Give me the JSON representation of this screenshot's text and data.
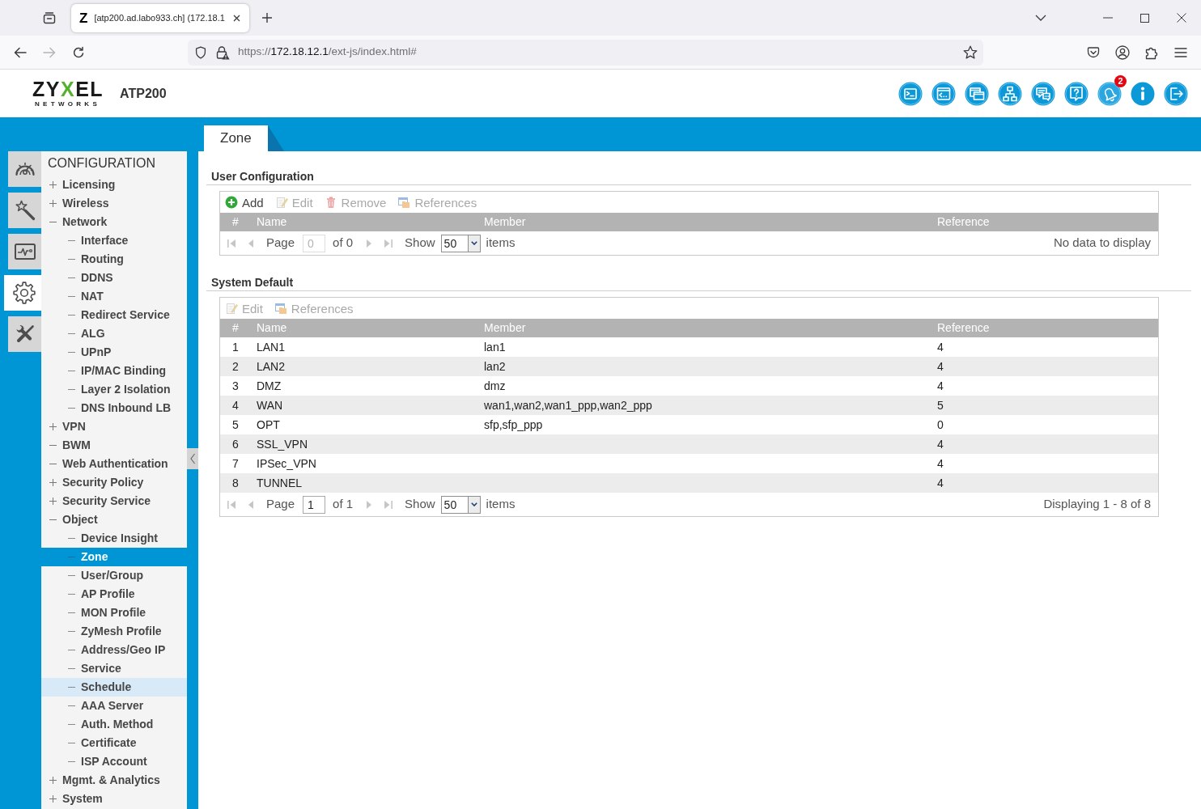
{
  "browser": {
    "tabs": [
      {
        "favicon": "Z",
        "title": "[atp200.ad.labo933.ch] (172.18.1",
        "selected": true
      }
    ],
    "back_disabled": false,
    "forward_disabled": true,
    "url": {
      "scheme": "https://",
      "host": "172.18.12.1",
      "path": "/ext-js/index.html#"
    }
  },
  "header": {
    "logo": {
      "before": "ZY",
      "accent": "X",
      "after": "EL",
      "tagline": "NETWORKS"
    },
    "model": "ATP200",
    "tools": [
      {
        "kind": "console"
      },
      {
        "kind": "cli"
      },
      {
        "kind": "windows"
      },
      {
        "kind": "topology"
      },
      {
        "kind": "chat"
      },
      {
        "kind": "help"
      },
      {
        "kind": "notifications",
        "badge": "2"
      },
      {
        "kind": "info"
      },
      {
        "kind": "logout"
      }
    ]
  },
  "page_tabs": [
    {
      "label": "Zone",
      "selected": true
    }
  ],
  "sidebar": {
    "modes": [
      {
        "kind": "dashboard",
        "selected": false
      },
      {
        "kind": "wizard",
        "selected": false
      },
      {
        "kind": "monitor",
        "selected": false
      },
      {
        "kind": "configuration",
        "selected": true
      },
      {
        "kind": "maintenance",
        "selected": false
      }
    ],
    "title": "CONFIGURATION",
    "items": [
      {
        "label": "Licensing",
        "expanded": false,
        "selected": false,
        "highlighted": false
      },
      {
        "label": "Wireless",
        "expanded": false,
        "selected": false,
        "highlighted": false
      },
      {
        "label": "Network",
        "expanded": true,
        "selected": false,
        "highlighted": false,
        "children": [
          {
            "label": "Interface",
            "selected": false,
            "highlighted": false
          },
          {
            "label": "Routing",
            "selected": false,
            "highlighted": false
          },
          {
            "label": "DDNS",
            "selected": false,
            "highlighted": false
          },
          {
            "label": "NAT",
            "selected": false,
            "highlighted": false
          },
          {
            "label": "Redirect Service",
            "selected": false,
            "highlighted": false
          },
          {
            "label": "ALG",
            "selected": false,
            "highlighted": false
          },
          {
            "label": "UPnP",
            "selected": false,
            "highlighted": false
          },
          {
            "label": "IP/MAC Binding",
            "selected": false,
            "highlighted": false
          },
          {
            "label": "Layer 2 Isolation",
            "selected": false,
            "highlighted": false
          },
          {
            "label": "DNS Inbound LB",
            "selected": false,
            "highlighted": false
          }
        ]
      },
      {
        "label": "VPN",
        "expanded": false,
        "selected": false,
        "highlighted": false
      },
      {
        "label": "BWM",
        "expanded": true,
        "selected": false,
        "highlighted": false
      },
      {
        "label": "Web Authentication",
        "expanded": true,
        "selected": false,
        "highlighted": false
      },
      {
        "label": "Security Policy",
        "expanded": false,
        "selected": false,
        "highlighted": false
      },
      {
        "label": "Security Service",
        "expanded": false,
        "selected": false,
        "highlighted": false
      },
      {
        "label": "Object",
        "expanded": true,
        "selected": false,
        "highlighted": false,
        "children": [
          {
            "label": "Device Insight",
            "selected": false,
            "highlighted": false
          },
          {
            "label": "Zone",
            "selected": true,
            "highlighted": false
          },
          {
            "label": "User/Group",
            "selected": false,
            "highlighted": false
          },
          {
            "label": "AP Profile",
            "selected": false,
            "highlighted": false
          },
          {
            "label": "MON Profile",
            "selected": false,
            "highlighted": false
          },
          {
            "label": "ZyMesh Profile",
            "selected": false,
            "highlighted": false
          },
          {
            "label": "Address/Geo IP",
            "selected": false,
            "highlighted": false
          },
          {
            "label": "Service",
            "selected": false,
            "highlighted": false
          },
          {
            "label": "Schedule",
            "selected": false,
            "highlighted": true
          },
          {
            "label": "AAA Server",
            "selected": false,
            "highlighted": false
          },
          {
            "label": "Auth. Method",
            "selected": false,
            "highlighted": false
          },
          {
            "label": "Certificate",
            "selected": false,
            "highlighted": false
          },
          {
            "label": "ISP Account",
            "selected": false,
            "highlighted": false
          }
        ]
      },
      {
        "label": "Mgmt. & Analytics",
        "expanded": false,
        "selected": false,
        "highlighted": false
      },
      {
        "label": "System",
        "expanded": false,
        "selected": false,
        "highlighted": false
      }
    ]
  },
  "sections": [
    {
      "title": "User Configuration",
      "toolbar": [
        {
          "kind": "add",
          "label": "Add",
          "disabled": false
        },
        {
          "kind": "edit",
          "label": "Edit",
          "disabled": true
        },
        {
          "kind": "remove",
          "label": "Remove",
          "disabled": true
        },
        {
          "kind": "references",
          "label": "References",
          "disabled": true
        }
      ],
      "columns": [
        "#",
        "Name",
        "Member",
        "Reference"
      ],
      "pager": {
        "page_label": "Page",
        "page": "0",
        "page_field_disabled": true,
        "page_count": "of 0",
        "show_label": "Show",
        "page_size": "50",
        "items_label": "items",
        "status": "No data to display",
        "nav_disabled": true
      }
    },
    {
      "title": "System Default",
      "toolbar": [
        {
          "kind": "edit",
          "label": "Edit",
          "disabled": true
        },
        {
          "kind": "references",
          "label": "References",
          "disabled": true
        }
      ],
      "columns": [
        "#",
        "Name",
        "Member",
        "Reference"
      ],
      "rows": [
        {
          "index": "1",
          "name": "LAN1",
          "member": "lan1",
          "reference": "4"
        },
        {
          "index": "2",
          "name": "LAN2",
          "member": "lan2",
          "reference": "4"
        },
        {
          "index": "3",
          "name": "DMZ",
          "member": "dmz",
          "reference": "4"
        },
        {
          "index": "4",
          "name": "WAN",
          "member": "wan1,wan2,wan1_ppp,wan2_ppp",
          "reference": "5"
        },
        {
          "index": "5",
          "name": "OPT",
          "member": "sfp,sfp_ppp",
          "reference": "0"
        },
        {
          "index": "6",
          "name": "SSL_VPN",
          "reference": "4"
        },
        {
          "index": "7",
          "name": "IPSec_VPN",
          "reference": "4"
        },
        {
          "index": "8",
          "name": "TUNNEL",
          "reference": "4"
        }
      ],
      "pager": {
        "page_label": "Page",
        "page": "1",
        "page_field_disabled": false,
        "page_count": "of 1",
        "show_label": "Show",
        "page_size": "50",
        "items_label": "items",
        "status": "Displaying 1 - 8 of 8",
        "nav_disabled": true
      }
    }
  ]
}
